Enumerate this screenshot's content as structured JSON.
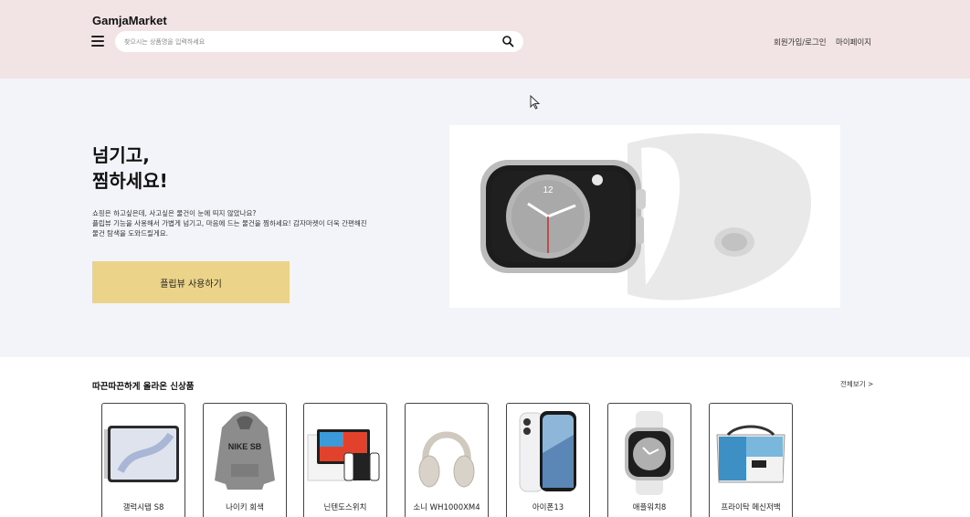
{
  "header": {
    "logo": "GamjaMarket",
    "search": {
      "placeholder": "찾으시는 상품명을 입력하세요",
      "value": ""
    },
    "nav": {
      "signup_login": "회원가입/로그인",
      "mypage": "마이페이지"
    }
  },
  "hero": {
    "title_line1": "넘기고,",
    "title_line2": "찜하세요!",
    "description": [
      "쇼핑은 하고싶은데, 사고싶은 물건이 눈에 띄지 않았나요?",
      "플립뷰 기능을 사용해서 가볍게 넘기고, 마음에 드는 물건을 찜하세요! 감자마켓이 더욱 간편해진",
      "물건 탐색을 도와드릴게요."
    ],
    "button_label": "플립뷰 사용하기",
    "image_icon": "smartwatch-image"
  },
  "new_products": {
    "title": "따끈따끈하게 올라온 신상품",
    "view_all": "전체보기 >",
    "items": [
      {
        "name": "갤럭시탭 S8",
        "icon": "tablet-image"
      },
      {
        "name": "나이키 회색",
        "icon": "hoodie-image"
      },
      {
        "name": "닌텐도스위치",
        "icon": "game-console-image"
      },
      {
        "name": "소니 WH1000XM4",
        "icon": "headphones-image"
      },
      {
        "name": "아이폰13",
        "icon": "smartphone-image"
      },
      {
        "name": "애플워치8",
        "icon": "smartwatch-image"
      },
      {
        "name": "프라이탁 메신저백",
        "icon": "messenger-bag-image"
      }
    ]
  },
  "colors": {
    "header_bg": "#f2e4e4",
    "hero_bg": "#f3f3fa",
    "accent_button": "#ebd489"
  }
}
